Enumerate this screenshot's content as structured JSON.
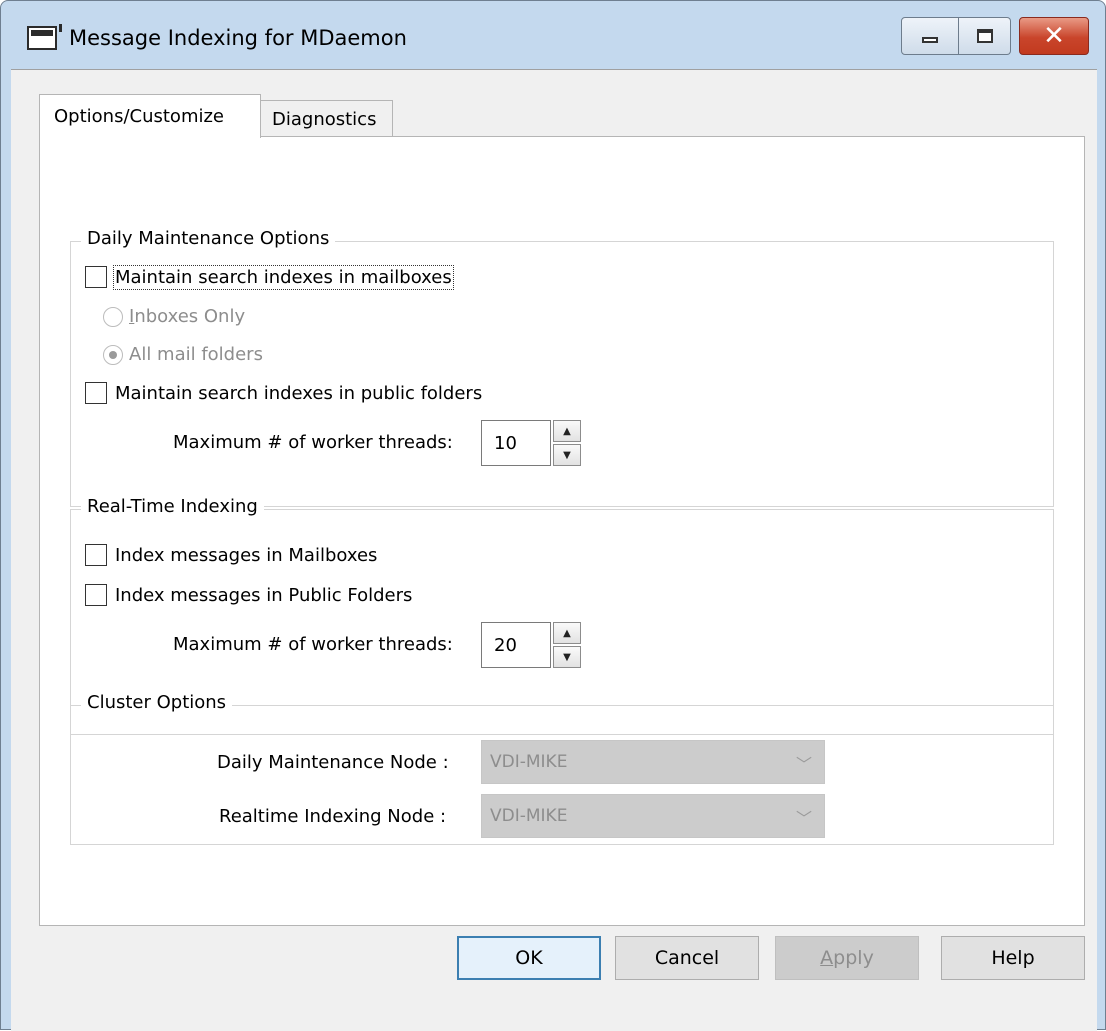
{
  "window": {
    "title": "Message Indexing for MDaemon",
    "close_glyph": "✕"
  },
  "tabs": [
    {
      "label": "Options/Customize",
      "active": true
    },
    {
      "label": "Diagnostics",
      "active": false
    }
  ],
  "daily_maintenance": {
    "title": "Daily Maintenance Options",
    "mailboxes_label": "Maintain search indexes in mailboxes",
    "mailboxes_checked": false,
    "inboxes_only_accel": "I",
    "inboxes_only_rest": "nboxes Only",
    "inboxes_only_selected": false,
    "all_folders_label": "All mail folders",
    "all_folders_selected": true,
    "public_label": "Maintain search indexes in public folders",
    "public_checked": false,
    "threads_label": "Maximum # of worker threads:",
    "threads_value": "10"
  },
  "realtime": {
    "title": "Real-Time Indexing",
    "mailboxes_label": "Index messages in Mailboxes",
    "mailboxes_checked": false,
    "public_label": "Index messages in Public Folders",
    "public_checked": false,
    "threads_label": "Maximum # of worker threads:",
    "threads_value": "20"
  },
  "cluster": {
    "title": "Cluster Options",
    "daily_node_label": "Daily Maintenance Node :",
    "daily_node_value": "VDI-MIKE",
    "realtime_node_label": "Realtime Indexing Node :",
    "realtime_node_value": "VDI-MIKE"
  },
  "buttons": {
    "ok": "OK",
    "cancel": "Cancel",
    "apply_accel": "A",
    "apply_rest": "pply",
    "help": "Help"
  },
  "icons": {
    "spin_up": "▲",
    "spin_down": "▼",
    "dropdown": "﹀"
  }
}
